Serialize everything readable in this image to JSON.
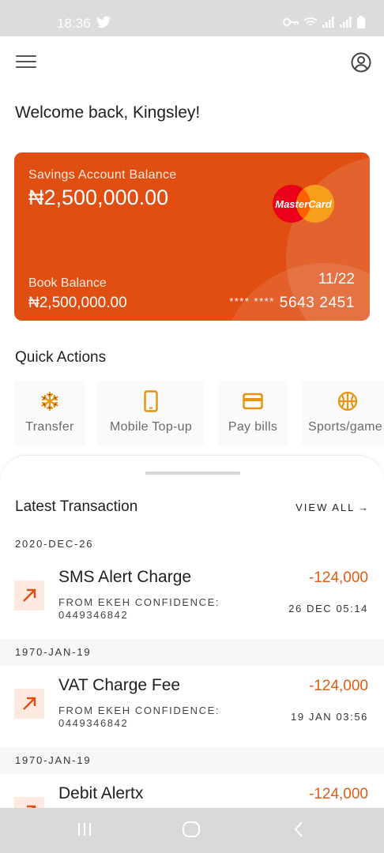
{
  "status_bar": {
    "time": "18:36"
  },
  "header": {
    "welcome": "Welcome back, Kingsley!"
  },
  "card": {
    "balance_label": "Savings Account Balance",
    "balance": "₦2,500,000.00",
    "brand": "MasterCard",
    "book_label": "Book Balance",
    "book_balance": "₦2,500,000.00",
    "expiry": "11/22",
    "number_mask": "**** ****",
    "number_last": "5643 2451"
  },
  "quick_actions": {
    "title": "Quick Actions",
    "items": [
      {
        "label": "Transfer",
        "icon": "snowflake-icon"
      },
      {
        "label": "Mobile Top-up",
        "icon": "phone-icon"
      },
      {
        "label": "Pay bills",
        "icon": "credit-card-icon"
      },
      {
        "label": "Sports/game",
        "icon": "basketball-icon"
      }
    ]
  },
  "transactions": {
    "title": "Latest Transaction",
    "view_all": "VIEW ALL",
    "groups": [
      {
        "date": "2020-DEC-26",
        "name": "SMS Alert Charge",
        "from": "FROM EKEH CONFIDENCE: 0449346842",
        "amount": "-124,000",
        "time": "26 DEC 05:14"
      },
      {
        "date": "1970-JAN-19",
        "name": "VAT Charge Fee",
        "from": "FROM EKEH CONFIDENCE: 0449346842",
        "amount": "-124,000",
        "time": "19 JAN 03:56"
      },
      {
        "date": "1970-JAN-19",
        "name": "Debit Alertx",
        "from": "",
        "amount": "-124,000",
        "time": ""
      }
    ]
  },
  "colors": {
    "accent": "#e04e12",
    "amount": "#e25b12",
    "icon": "#e89412"
  }
}
